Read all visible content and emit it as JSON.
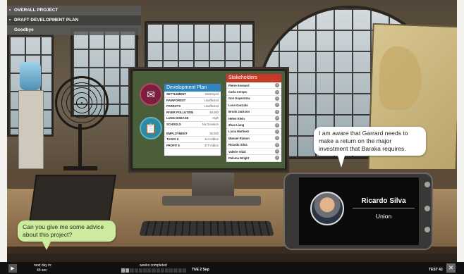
{
  "menu": {
    "overall_project": "OVERALL PROJECT",
    "draft_plan": "DRAFT DEVELOPMENT PLAN",
    "goodbye": "Goodbye"
  },
  "dev_plan": {
    "title": "Development Plan",
    "rows": [
      {
        "key": "SETTLEMENT",
        "value": "Destroyed"
      },
      {
        "key": "RAINFOREST",
        "value": "Unaffected"
      },
      {
        "key": "PARROTS",
        "value": "Unaffected"
      },
      {
        "key": "RIVER POLLUTION",
        "value": "48,000"
      },
      {
        "key": "LUNG DISEASE",
        "value": "High"
      },
      {
        "key": "SCHOOLS",
        "value": "No Donation"
      }
    ],
    "finance": [
      {
        "key": "EMPLOYMENT",
        "value": "38,000"
      },
      {
        "key": "TAXES $",
        "value": "144 million"
      },
      {
        "key": "PROFIT $",
        "value": "377 million"
      }
    ]
  },
  "stakeholders": {
    "title": "Stakeholders",
    "names": [
      "Pierre Evenard",
      "Carla Crespo",
      "Gon Esperanza",
      "Leon Gonzalo",
      "Brook Jackson",
      "Helen Klein",
      "Zhao Liang",
      "Lucia Martinez",
      "Manuel Ramon",
      "Ricardo Silva",
      "Valerie Vidal",
      "Paloma Wright"
    ]
  },
  "speech_right": "I am aware that Garrard needs to make a return on the major investment that Baraka requires.",
  "speech_left": "Can you give me some advice about this project?",
  "caller": {
    "name": "Ricardo Silva",
    "group": "Union"
  },
  "bottom": {
    "next_day_label": "next day in:",
    "next_day_time": "45 sec",
    "weeks_label": "weeks completed",
    "weeks_completed": 2,
    "weeks_total": 15,
    "date": "TUE 2 Sep",
    "test": "TEST 42"
  },
  "icons": [
    "mail-icon",
    "clipboard-icon",
    "play-icon",
    "close-icon",
    "info-icon"
  ]
}
